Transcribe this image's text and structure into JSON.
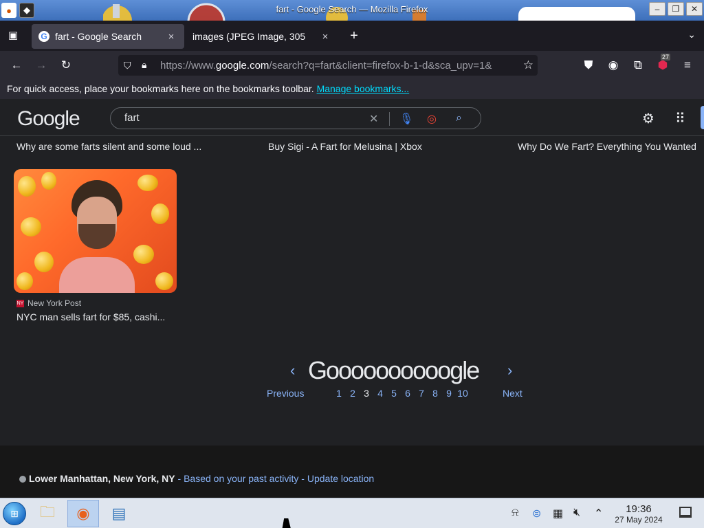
{
  "window": {
    "title": "fart - Google Search — Mozilla Firefox"
  },
  "tabs": [
    {
      "label": "fart - Google Search",
      "close": "×"
    },
    {
      "label": "images (JPEG Image, 305",
      "close": "×"
    }
  ],
  "newtab": "+",
  "nav": {
    "url_prefix": "https://www.",
    "url_domain": "google.com",
    "url_rest": "/search?q=fart&client=firefox-b-1-d&sca_upv=1&",
    "notification_count": "27"
  },
  "bookmarks_bar": {
    "message": "For quick access, place your bookmarks here on the bookmarks toolbar.",
    "link": "Manage bookmarks..."
  },
  "google": {
    "logo": "Google",
    "query": "fart",
    "results_top": [
      "Why are some farts silent and some loud ...",
      "Buy Sigi - A Fart for Melusina | Xbox",
      "Why Do We Fart? Everything You Wanted"
    ],
    "result_image": {
      "source": "New York Post",
      "title": "NYC man sells fart for $85, cashi..."
    },
    "pager": {
      "logo": "Goooooooooogle",
      "prev": "Previous",
      "next": "Next",
      "pages": [
        "1",
        "2",
        "3",
        "4",
        "5",
        "6",
        "7",
        "8",
        "9",
        "10"
      ]
    },
    "footer": {
      "location": "Lower Manhattan, New York, NY",
      "sep1": " - ",
      "based": "Based on your past activity",
      "sep2": " - ",
      "update": "Update location"
    }
  },
  "taskbar": {
    "time": "19:36",
    "date": "27 May 2024"
  },
  "colors": {
    "link": "#8ab4f8",
    "bg": "#202124",
    "accent": "#00ddff"
  }
}
